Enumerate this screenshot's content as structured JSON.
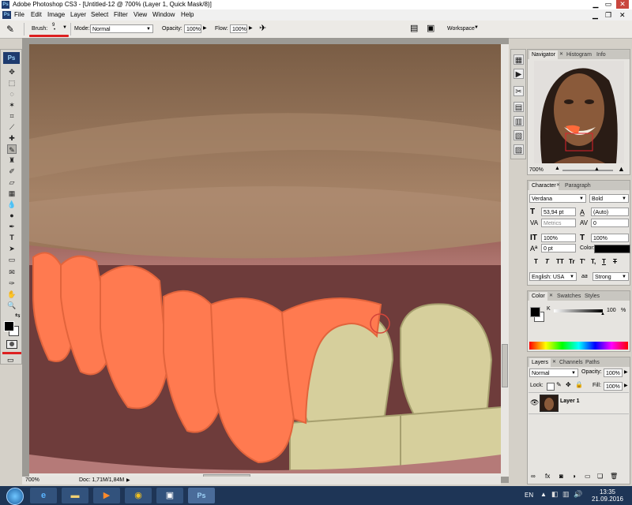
{
  "window": {
    "title": "Adobe Photoshop CS3 - [Untitled-12 @ 700% (Layer 1, Quick Mask/8)]",
    "app_badge": "Ps"
  },
  "menu": [
    "File",
    "Edit",
    "Image",
    "Layer",
    "Select",
    "Filter",
    "View",
    "Window",
    "Help"
  ],
  "options": {
    "brush_label": "Brush:",
    "brush_size": "9",
    "mode_label": "Mode:",
    "mode_value": "Normal",
    "opacity_label": "Opacity:",
    "opacity_value": "100%",
    "flow_label": "Flow:",
    "flow_value": "100%",
    "workspace_label": "Workspace"
  },
  "status": {
    "zoom": "700%",
    "doc": "Doc: 1,71M/1,84M"
  },
  "navigator": {
    "tabs": [
      "Navigator",
      "Histogram",
      "Info"
    ],
    "zoom": "700%"
  },
  "character": {
    "tabs": [
      "Character",
      "Paragraph"
    ],
    "font_family": "Verdana",
    "font_style": "Bold",
    "font_size": "53,94 pt",
    "leading": "(Auto)",
    "kerning": "Metrics",
    "tracking": "0",
    "vertical_scale": "100%",
    "horizontal_scale": "100%",
    "baseline_shift": "0 pt",
    "color_label": "Color:",
    "style_buttons": [
      "T",
      "T",
      "TT",
      "Tr",
      "T'",
      "T,",
      "T",
      "T"
    ],
    "language": "English: USA",
    "antialias_icon": "aa",
    "antialias": "Strong"
  },
  "color_panel": {
    "tabs": [
      "Color",
      "Swatches",
      "Styles"
    ],
    "channel": "K",
    "value": "100",
    "unit": "%"
  },
  "layers": {
    "tabs": [
      "Layers",
      "Channels",
      "Paths"
    ],
    "blend_mode": "Normal",
    "opacity_label": "Opacity:",
    "opacity": "100%",
    "lock_label": "Lock:",
    "fill_label": "Fill:",
    "fill": "100%",
    "items": [
      {
        "name": "Layer 1",
        "visible": true
      }
    ]
  },
  "taskbar": {
    "language": "EN",
    "time": "13:35",
    "date": "21.09.2016"
  },
  "colors": {
    "mask_overlay": "#ff7a50",
    "teeth": "#d6cf9c",
    "lips": "#be7b7b",
    "skin": "#8f6a4c",
    "annotation": "#dd2020"
  }
}
